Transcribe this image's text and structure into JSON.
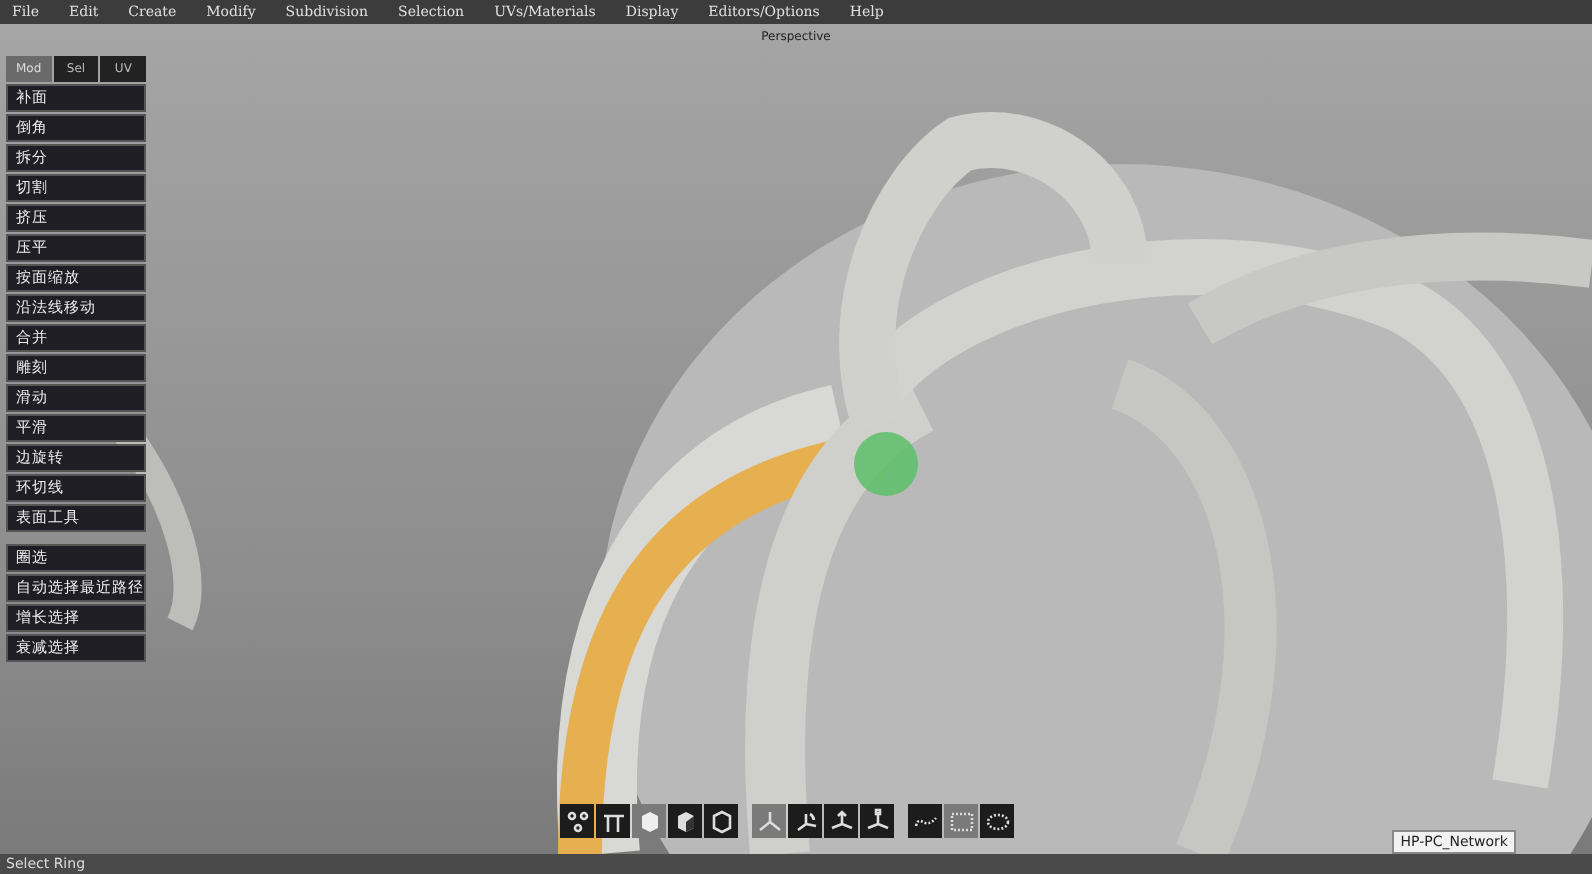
{
  "menu": [
    "File",
    "Edit",
    "Create",
    "Modify",
    "Subdivision",
    "Selection",
    "UVs/Materials",
    "Display",
    "Editors/Options",
    "Help"
  ],
  "viewport": {
    "title": "Perspective"
  },
  "panel": {
    "tabs": [
      {
        "label": "Mod",
        "selected": true
      },
      {
        "label": "Sel",
        "selected": false
      },
      {
        "label": "UV",
        "selected": false
      }
    ],
    "groups": [
      [
        "补面",
        "倒角",
        "拆分",
        "切割",
        "挤压",
        "压平",
        "按面缩放",
        "沿法线移动",
        "合并",
        "雕刻",
        "滑动",
        "平滑",
        "边旋转",
        "环切线",
        "表面工具"
      ],
      [
        "圈选",
        "自动选择最近路径",
        "增长选择",
        "衰减选择"
      ]
    ]
  },
  "toolbar": [
    [
      {
        "kind": "verts",
        "selected": false
      },
      {
        "kind": "edges",
        "selected": false
      },
      {
        "kind": "faces",
        "selected": true
      },
      {
        "kind": "objfaces",
        "selected": false
      },
      {
        "kind": "object",
        "selected": false
      }
    ],
    [
      {
        "kind": "tri",
        "selected": true
      },
      {
        "kind": "rot",
        "selected": false
      },
      {
        "kind": "move",
        "selected": false
      },
      {
        "kind": "scale",
        "selected": false
      }
    ],
    [
      {
        "kind": "lasso",
        "selected": false
      },
      {
        "kind": "rect",
        "selected": true
      },
      {
        "kind": "paint",
        "selected": false
      }
    ]
  ],
  "tooltip": "HP-PC_Network",
  "status_bar": "Select Ring"
}
